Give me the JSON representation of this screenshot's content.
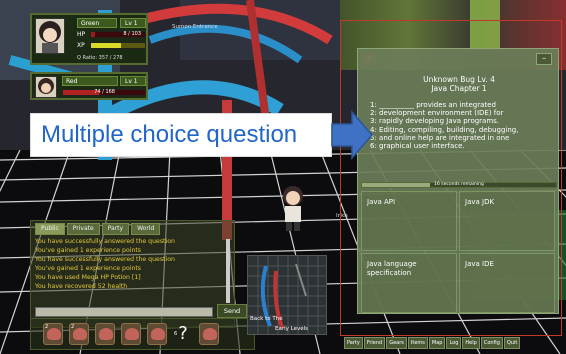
{
  "world": {
    "location_tag": "Sumon Entrance",
    "side_tag": "Inkn"
  },
  "players": [
    {
      "name": "Green",
      "level": "Lv 1",
      "hp_label": "HP",
      "hp": "8 / 103",
      "hp_fraction": 0.08,
      "xp_label": "XP",
      "xp": "",
      "xp_fraction": 0.55,
      "q_ratio": "Q Ratio: 357 / 278"
    },
    {
      "name": "Red",
      "level": "Lv 1",
      "hp": "74 / 168",
      "hp_fraction": 0.44
    }
  ],
  "chat": {
    "tabs": [
      "Public",
      "Private",
      "Party",
      "World"
    ],
    "lines": [
      "You have successfully answered the question",
      "You've gained 1 experience points",
      "You have successfully answered the question",
      "You've gained 1 experience points",
      "You have used Mega HP Potion [1]",
      "You have recovered 52 health"
    ],
    "send_label": "Send",
    "send_arrow": "−"
  },
  "inventory": {
    "slots": [
      {
        "count": "2",
        "icon": "crab-icon"
      },
      {
        "count": "2",
        "icon": "crab-icon"
      },
      {
        "count": "",
        "icon": "crab-icon"
      },
      {
        "count": "",
        "icon": "crab-icon"
      },
      {
        "count": "",
        "icon": "crab-icon"
      },
      {
        "count": "6",
        "icon": "question-icon",
        "glyph": "?"
      },
      {
        "count": "",
        "icon": "crab-icon"
      }
    ]
  },
  "minimap": {
    "label": "Back to The",
    "label2": "Early Levels"
  },
  "question": {
    "number": "1",
    "close": "−",
    "title": "Unknown Bug Lv. 4",
    "subtitle": "Java Chapter 1",
    "body_lines": [
      "1: __________ provides an integrated",
      "2: development environment (IDE) for",
      "3: rapidly developing Java programs.",
      "4: Editing, compiling, building, debugging,",
      "5: and online help are integrated in one",
      "6: graphical user interface."
    ],
    "timer_text": "16 seconds remaining",
    "timer_fraction": 0.35,
    "answers": [
      "Java API",
      "Java JDK",
      "Java language specification",
      "Java IDE"
    ]
  },
  "menu": [
    "Party",
    "Friend",
    "Gears",
    "Items",
    "Map",
    "Log",
    "Help",
    "Config",
    "Quit"
  ],
  "overlay": {
    "label": "Multiple choice question"
  },
  "colors": {
    "accent_red": "#c0392b",
    "panel_green": "#6b7d58",
    "chat_yellow": "#e3c93a",
    "overlay_text": "#2166c8",
    "arrow_blue": "#3f72c4"
  }
}
